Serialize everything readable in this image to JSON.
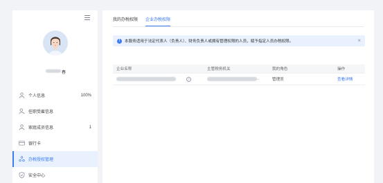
{
  "sidebar": {
    "username_suffix": "春",
    "items": [
      {
        "label": "个人信息",
        "extra": "100%",
        "icon": "user-icon"
      },
      {
        "label": "任职受雇信息",
        "extra": "",
        "icon": "employment-icon"
      },
      {
        "label": "家庭成员信息",
        "extra": "1",
        "icon": "family-icon"
      },
      {
        "label": "银行卡",
        "extra": "",
        "icon": "bank-card-icon"
      },
      {
        "label": "办税授权管理",
        "extra": "",
        "icon": "authorization-icon",
        "active": true
      },
      {
        "label": "安全中心",
        "extra": "",
        "icon": "shield-icon"
      }
    ]
  },
  "tabs": [
    {
      "label": "我的办税权限",
      "active": false
    },
    {
      "label": "企业办税权限",
      "active": true
    }
  ],
  "alert": {
    "text": "本服务适用于法定代表人（负责人）、财务负责人或拥有管理权限的人员，赋予指定人员办税权限。",
    "close": "×"
  },
  "table": {
    "headers": [
      "企业名称",
      "主管税务机关",
      "我的角色",
      "操作"
    ],
    "rows": [
      {
        "company": "",
        "tax_office_suffix": "..",
        "role": "管理员",
        "action": "查看详情"
      }
    ]
  },
  "colors": {
    "accent": "#3d7bf0",
    "background": "#f1f3f7",
    "alert_bg": "#e8f1fd"
  }
}
